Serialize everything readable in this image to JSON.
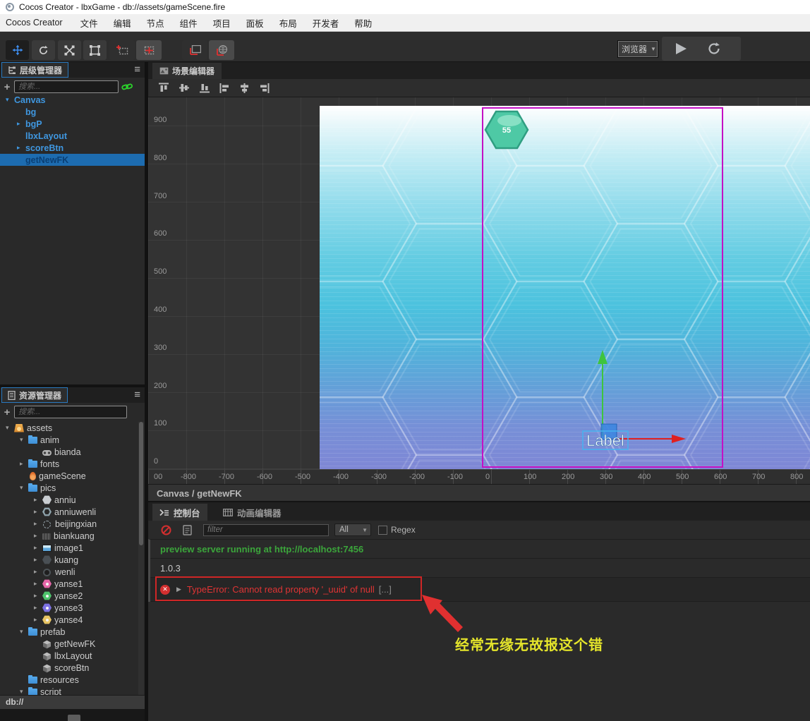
{
  "window": {
    "title": "Cocos Creator - lbxGame - db://assets/gameScene.fire",
    "menu": [
      "Cocos Creator",
      "文件",
      "编辑",
      "节点",
      "组件",
      "项目",
      "面板",
      "布局",
      "开发者",
      "帮助"
    ]
  },
  "toolbar": {
    "tools": [
      "move-tool",
      "rotate-tool",
      "scale-tool",
      "rect-tool",
      "pivot-anchor-toggle",
      "anchor-grid-toggle",
      "local-gizmo-toggle",
      "global-gizmo-toggle"
    ],
    "preview_target": "浏览器",
    "actions": [
      "play",
      "refresh"
    ]
  },
  "hierarchy": {
    "title": "层级管理器",
    "search_placeholder": "搜索...",
    "nodes": [
      {
        "label": "Canvas",
        "depth": 0,
        "arrow": "down"
      },
      {
        "label": "bg",
        "depth": 1,
        "arrow": "none"
      },
      {
        "label": "bgP",
        "depth": 1,
        "arrow": "right"
      },
      {
        "label": "lbxLayout",
        "depth": 1,
        "arrow": "none"
      },
      {
        "label": "scoreBtn",
        "depth": 1,
        "arrow": "right"
      },
      {
        "label": "getNewFK",
        "depth": 1,
        "arrow": "none",
        "selected": true
      }
    ]
  },
  "assets": {
    "title": "资源管理器",
    "search_placeholder": "搜索...",
    "status": "db://",
    "items": [
      {
        "label": "assets",
        "depth": 0,
        "arrow": "down",
        "icon": "bundle"
      },
      {
        "label": "anim",
        "depth": 1,
        "arrow": "down",
        "icon": "folder"
      },
      {
        "label": "bianda",
        "depth": 2,
        "arrow": "none",
        "icon": "anim"
      },
      {
        "label": "fonts",
        "depth": 1,
        "arrow": "right",
        "icon": "folder"
      },
      {
        "label": "gameScene",
        "depth": 1,
        "arrow": "none",
        "icon": "fire"
      },
      {
        "label": "pics",
        "depth": 1,
        "arrow": "down",
        "icon": "folder"
      },
      {
        "label": "anniu",
        "depth": 2,
        "arrow": "right",
        "icon": "hex",
        "color": "#c9cdd1"
      },
      {
        "label": "anniuwenli",
        "depth": 2,
        "arrow": "right",
        "icon": "hexo",
        "color": "#8fa3ac"
      },
      {
        "label": "beijingxian",
        "depth": 2,
        "arrow": "right",
        "icon": "dash"
      },
      {
        "label": "biankuang",
        "depth": 2,
        "arrow": "right",
        "icon": "tex"
      },
      {
        "label": "image1",
        "depth": 2,
        "arrow": "right",
        "icon": "img"
      },
      {
        "label": "kuang",
        "depth": 2,
        "arrow": "right",
        "icon": "hex",
        "color": "#4a5055"
      },
      {
        "label": "wenli",
        "depth": 2,
        "arrow": "right",
        "icon": "ring"
      },
      {
        "label": "yanse1",
        "depth": 2,
        "arrow": "right",
        "icon": "hexdot",
        "color": "#e566a8"
      },
      {
        "label": "yanse2",
        "depth": 2,
        "arrow": "right",
        "icon": "hexdot",
        "color": "#4ec46c"
      },
      {
        "label": "yanse3",
        "depth": 2,
        "arrow": "right",
        "icon": "hexdot",
        "color": "#7d72e3"
      },
      {
        "label": "yanse4",
        "depth": 2,
        "arrow": "right",
        "icon": "hexdot",
        "color": "#e8c564"
      },
      {
        "label": "prefab",
        "depth": 1,
        "arrow": "down",
        "icon": "folder"
      },
      {
        "label": "getNewFK",
        "depth": 2,
        "arrow": "none",
        "icon": "prefab"
      },
      {
        "label": "lbxLayout",
        "depth": 2,
        "arrow": "none",
        "icon": "prefab"
      },
      {
        "label": "scoreBtn",
        "depth": 2,
        "arrow": "none",
        "icon": "prefab"
      },
      {
        "label": "resources",
        "depth": 1,
        "arrow": "none",
        "icon": "folder"
      },
      {
        "label": "script",
        "depth": 1,
        "arrow": "down",
        "icon": "folder"
      }
    ]
  },
  "scene": {
    "tab": "场景编辑器",
    "align_tools": [
      "align-top",
      "align-middle",
      "align-bottom",
      "align-left",
      "align-center",
      "align-right"
    ],
    "vruler": [
      "900",
      "800",
      "700",
      "600",
      "500",
      "400",
      "300",
      "200",
      "100",
      "0"
    ],
    "hruler": [
      "00",
      "-800",
      "-700",
      "-600",
      "-500",
      "-400",
      "-300",
      "-200",
      "-100",
      "0",
      "100",
      "200",
      "300",
      "400",
      "500",
      "600",
      "700",
      "800"
    ],
    "hex_label": "55",
    "label_text": "Label",
    "breadcrumb": "Canvas / getNewFK"
  },
  "console": {
    "tab": "控制台",
    "anim_tab": "动画编辑器",
    "filter_placeholder": "filter",
    "level": "All",
    "regex_label": "Regex",
    "logs": [
      {
        "type": "info",
        "text": "preview server running at http://localhost:7456"
      },
      {
        "type": "plain",
        "text": "1.0.3"
      },
      {
        "type": "error",
        "text": "TypeError: Cannot read property '_uuid' of null",
        "suffix": "[...]"
      }
    ],
    "annotation": "经常无缘无故报这个错"
  },
  "colors": {
    "selection": "#1d6cb0",
    "hierarchy_text": "#3f97e0",
    "canvas_border": "#c410c4",
    "success_log": "#3ba53b",
    "error_log": "#df3434",
    "annotation_text": "#e5e52b",
    "annotation_arrow": "#e03030",
    "game_hexagon": "#4ec9a5"
  }
}
